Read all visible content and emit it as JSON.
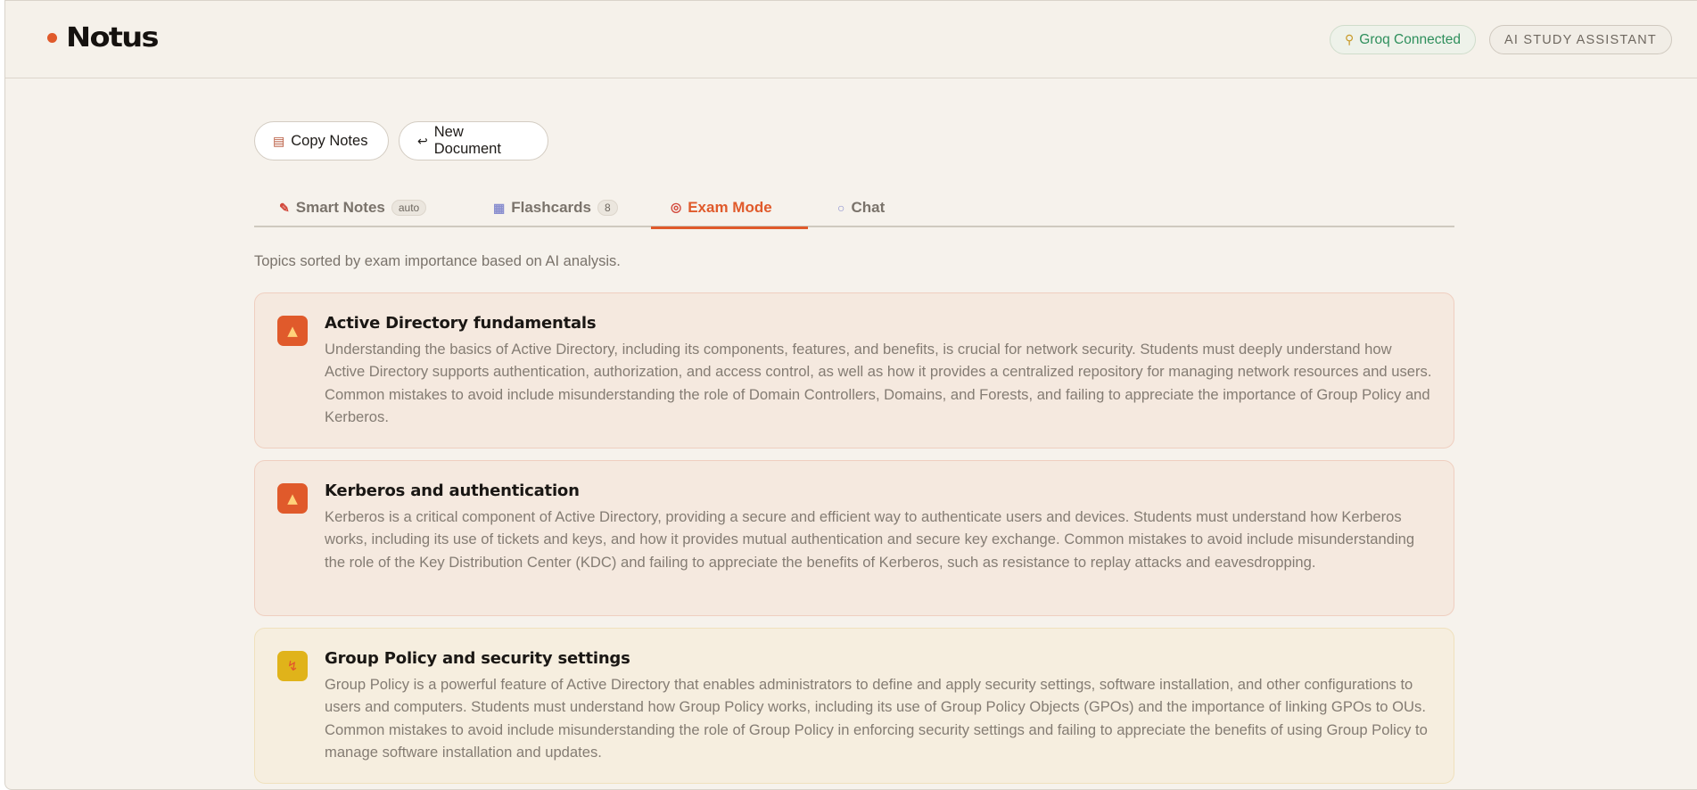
{
  "header": {
    "logo_text": "Notus",
    "groq_status": "Groq Connected",
    "assistant_label": "AI STUDY ASSISTANT"
  },
  "actions": {
    "copy_label": "Copy Notes",
    "new_label": "New Document"
  },
  "tabs": [
    {
      "label": "Smart Notes",
      "badge": "auto"
    },
    {
      "label": "Flashcards",
      "badge": "8"
    },
    {
      "label": "Exam Mode",
      "active": true
    },
    {
      "label": "Chat"
    }
  ],
  "subtitle": "Topics sorted by exam importance based on AI analysis.",
  "topics": [
    {
      "priority": "high",
      "icon": "fire-icon",
      "title": "Active Directory fundamentals",
      "body": "Understanding the basics of Active Directory, including its components, features, and benefits, is crucial for network security. Students must deeply understand how Active Directory supports authentication, authorization, and access control, as well as how it provides a centralized repository for managing network resources and users. Common mistakes to avoid include misunderstanding the role of Domain Controllers, Domains, and Forests, and failing to appreciate the importance of Group Policy and Kerberos."
    },
    {
      "priority": "high",
      "icon": "fire-icon",
      "title": "Kerberos and authentication",
      "body": "Kerberos is a critical component of Active Directory, providing a secure and efficient way to authenticate users and devices. Students must understand how Kerberos works, including its use of tickets and keys, and how it provides mutual authentication and secure key exchange. Common mistakes to avoid include misunderstanding the role of the Key Distribution Center (KDC) and failing to appreciate the benefits of Kerberos, such as resistance to replay attacks and eavesdropping."
    },
    {
      "priority": "medium",
      "icon": "lightning-icon",
      "title": "Group Policy and security settings",
      "body": "Group Policy is a powerful feature of Active Directory that enables administrators to define and apply security settings, software installation, and other configurations to users and computers. Students must understand how Group Policy works, including its use of Group Policy Objects (GPOs) and the importance of linking GPOs to OUs. Common mistakes to avoid include misunderstanding the role of Group Policy in enforcing security settings and failing to appreciate the benefits of using Group Policy to manage software installation and updates."
    }
  ],
  "colors": {
    "accent": "#e05a2b",
    "background": "#f6f2ec",
    "high_card": "#f5e9df",
    "medium_card": "#f6eedf",
    "connected_green": "#2e8f5c"
  }
}
